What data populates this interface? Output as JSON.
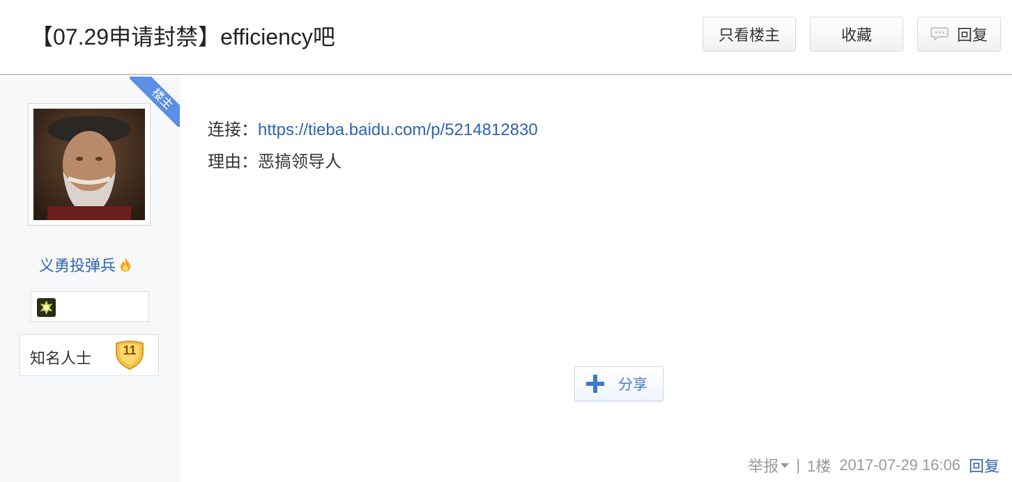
{
  "header": {
    "title": "【07.29申请封禁】efficiency吧",
    "only_op_label": "只看楼主",
    "favorite_label": "收藏",
    "reply_label": "回复"
  },
  "author": {
    "op_tag": "楼主",
    "username": "义勇投弹兵",
    "rank_title": "知名人士",
    "level": "11"
  },
  "post": {
    "link_label": "连接：",
    "link_url": "https://tieba.baidu.com/p/5214812830",
    "reason_label": "理由：",
    "reason_text": "恶搞领导人",
    "share_label": "分享"
  },
  "footer": {
    "report_label": "举报",
    "separator": "|",
    "floor": "1楼",
    "timestamp": "2017-07-29 16:06",
    "reply_label": "回复"
  },
  "colors": {
    "link": "#2d64b3",
    "op_ribbon": "#5b8ee6",
    "sidebar_bg": "#f7f8fa",
    "muted": "#999999"
  },
  "icons": [
    "speech-bubble-icon",
    "fire-icon",
    "medal-icon",
    "level-badge-icon",
    "share-plus-icon",
    "dropdown-triangle-icon"
  ]
}
